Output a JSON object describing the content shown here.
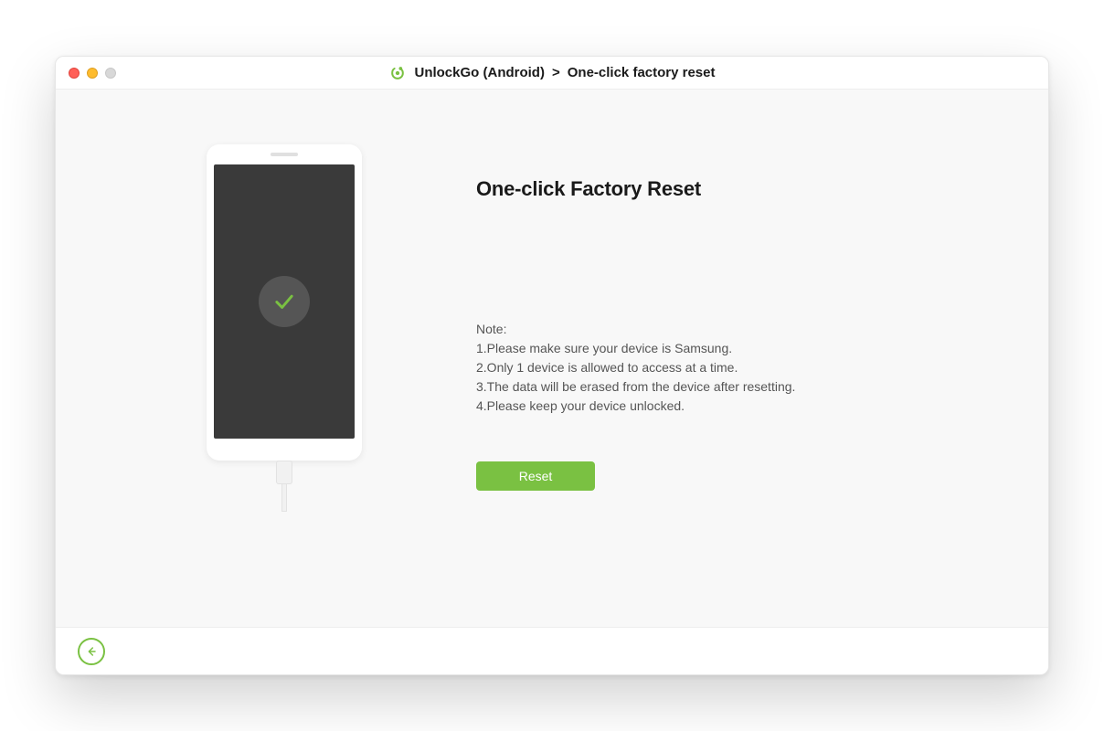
{
  "titlebar": {
    "app_name": "UnlockGo (Android)",
    "separator": ">",
    "section": "One-click factory reset"
  },
  "main": {
    "heading": "One-click Factory Reset",
    "note_label": "Note:",
    "notes": [
      "1.Please make sure your device is Samsung.",
      "2.Only 1 device is allowed to access at a time.",
      "3.The data will be erased from the device after resetting.",
      "4.Please keep your device unlocked."
    ],
    "reset_button": "Reset"
  },
  "colors": {
    "accent": "#7ac142"
  }
}
